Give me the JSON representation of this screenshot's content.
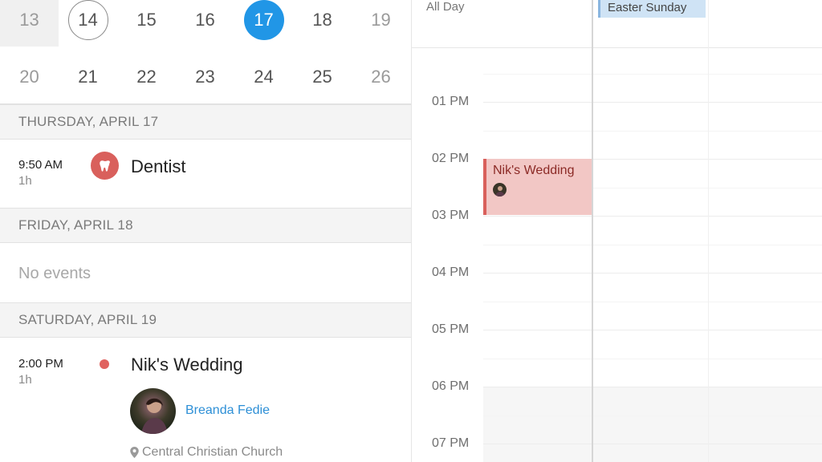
{
  "calendar": {
    "week1": [
      {
        "n": "13",
        "style": "muted-grey"
      },
      {
        "n": "14",
        "style": "today"
      },
      {
        "n": "15",
        "style": "normal"
      },
      {
        "n": "16",
        "style": "normal"
      },
      {
        "n": "17",
        "style": "selected"
      },
      {
        "n": "18",
        "style": "normal"
      },
      {
        "n": "19",
        "style": "muted"
      }
    ],
    "week2": [
      {
        "n": "20",
        "style": "muted"
      },
      {
        "n": "21",
        "style": "normal"
      },
      {
        "n": "22",
        "style": "normal"
      },
      {
        "n": "23",
        "style": "normal"
      },
      {
        "n": "24",
        "style": "normal"
      },
      {
        "n": "25",
        "style": "normal"
      },
      {
        "n": "26",
        "style": "muted"
      }
    ],
    "selected_color": "#2196e6"
  },
  "agenda": {
    "thursday": {
      "header": "THURSDAY, APRIL 17",
      "event": {
        "time": "9:50 AM",
        "duration": "1h",
        "title": "Dentist",
        "icon": "tooth-icon",
        "color": "#d9605c"
      }
    },
    "friday": {
      "header": "FRIDAY, APRIL 18",
      "empty_text": "No events"
    },
    "saturday": {
      "header": "SATURDAY, APRIL 19",
      "event": {
        "time": "2:00 PM",
        "duration": "1h",
        "title": "Nik's Wedding",
        "color": "#e06360",
        "attendee": "Breanda Fedie",
        "location": "Central Christian Church",
        "location_icon": "location-pin-icon"
      }
    }
  },
  "day_view": {
    "all_day_label": "All Day",
    "all_day_event": "Easter Sunday",
    "hours": [
      "01 PM",
      "02 PM",
      "03 PM",
      "04 PM",
      "05 PM",
      "06 PM",
      "07 PM"
    ],
    "event": {
      "title": "Nik's Wedding",
      "color": "#f2c7c5",
      "accent": "#d9605c"
    }
  }
}
